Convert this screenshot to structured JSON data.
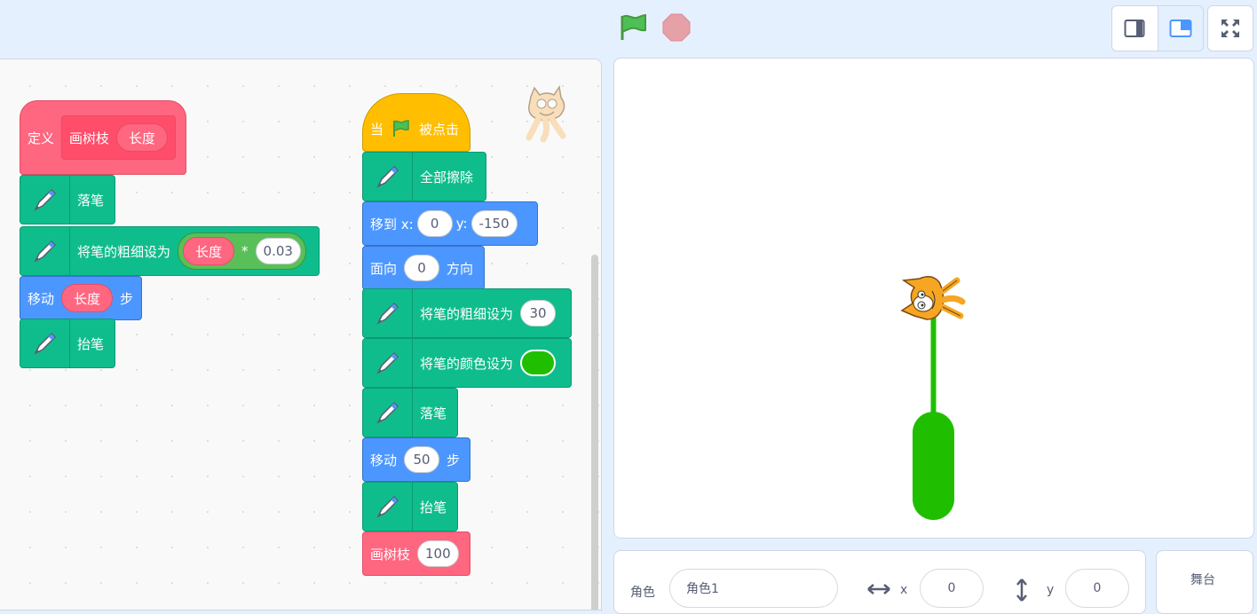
{
  "controls": {
    "green_flag": "green-flag-icon",
    "stop": "stop-sign-icon",
    "small_stage": "small-stage-icon",
    "normal_stage": "normal-stage-icon",
    "fullscreen": "fullscreen-icon"
  },
  "script_define": {
    "define_label": "定义",
    "proc_name": "画树枝",
    "param": "长度",
    "pen_down": "落笔",
    "set_size": "将笔的粗细设为",
    "size_param": "长度",
    "multiply": "*",
    "factor": "0.03",
    "move": "移动",
    "move_param": "长度",
    "steps": "步",
    "pen_up": "抬笔"
  },
  "script_main": {
    "when": "当",
    "clicked": "被点击",
    "erase_all": "全部擦除",
    "goto_x": "移到 x:",
    "x_val": "0",
    "goto_y": "y:",
    "y_val": "-150",
    "point_in": "面向",
    "dir_val": "0",
    "direction": "方向",
    "set_size": "将笔的粗细设为",
    "size_val": "30",
    "set_color": "将笔的颜色设为",
    "pen_color": "#1fbf00",
    "pen_down": "落笔",
    "move": "移动",
    "move_val": "50",
    "steps": "步",
    "pen_up": "抬笔",
    "call": "画树枝",
    "call_val": "100"
  },
  "sprite_info": {
    "sprite_label": "角色",
    "sprite_name": "角色1",
    "x_label": "x",
    "x_val": "0",
    "y_label": "y",
    "y_val": "0"
  },
  "stage_selector": {
    "label": "舞台"
  }
}
